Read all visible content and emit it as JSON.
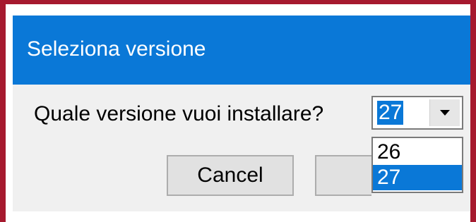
{
  "window": {
    "title": "Seleziona versione",
    "colors": {
      "titlebar": "#0a78d7",
      "border": "#a6192e",
      "client": "#f0f0f0"
    }
  },
  "prompt": {
    "question": "Quale versione vuoi installare?"
  },
  "version_select": {
    "selected": "27",
    "expanded": true,
    "options": [
      "26",
      "27"
    ],
    "highlighted_option": "27",
    "icon": "chevron-down-icon"
  },
  "buttons": {
    "cancel_label": "Cancel",
    "ok_label": ""
  }
}
